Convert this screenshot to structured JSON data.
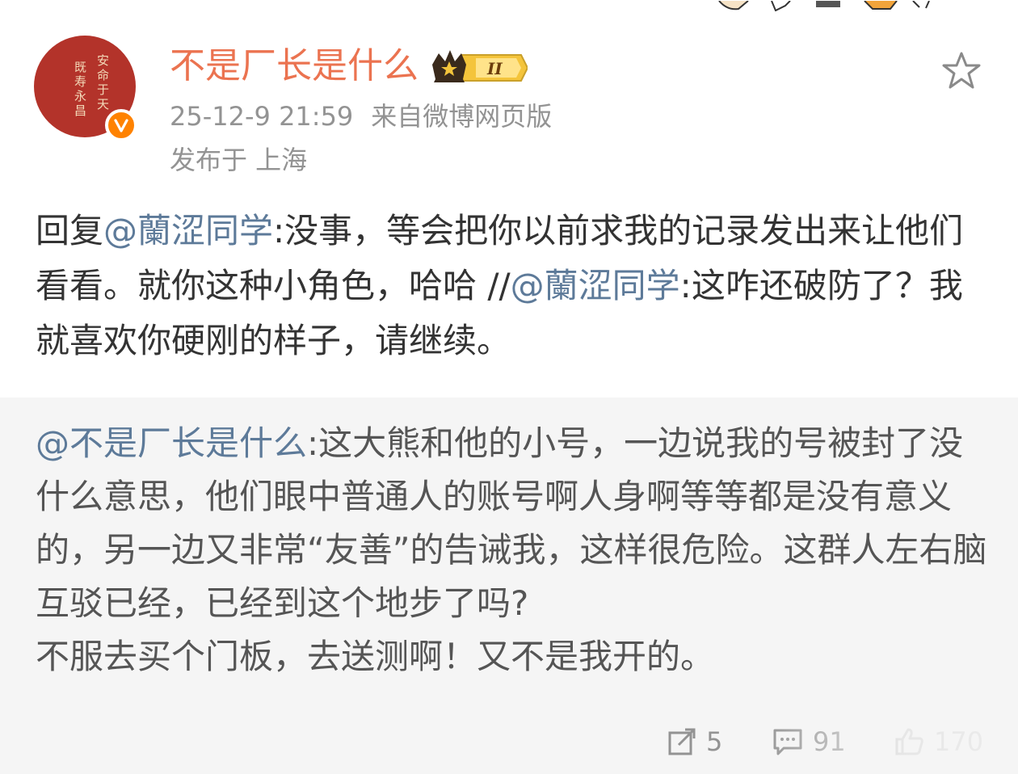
{
  "author": {
    "name": "不是厂长是什么",
    "avatar_seal_text": "安命于天 既寿永昌",
    "verified_icon": "verified-badge-icon",
    "vip_badge_icon": "crown-level-badge-icon",
    "vip_level": "II"
  },
  "meta": {
    "datetime": "25-12-9 21:59",
    "source": "来自微博网页版",
    "location": "发布于 上海"
  },
  "post": {
    "prefix": "回复",
    "mention1": "@蘭涩同学",
    "text1": ":没事，等会把你以前求我的记录发出来让他们看看。就你这种小角色，哈哈 //",
    "mention2": "@蘭涩同学",
    "text2": ":这咋还破防了？我就喜欢你硬刚的样子，请继续。"
  },
  "retweet": {
    "mention": "@不是厂长是什么",
    "text": ":这大熊和他的小号，一边说我的号被封了没什么意思，他们眼中普通人的账号啊人身啊等等都是没有意义的，另一边又非常“友善”的告诫我，这样很危险。这群人左右脑互驳已经，已经到这个地步了吗?",
    "text2": "不服去买个门板，去送测啊！又不是我开的。"
  },
  "actions": {
    "repost_count": "5",
    "comment_count": "91",
    "like_count": "170"
  },
  "colors": {
    "name": "#eb7350",
    "mention": "#5d7a99",
    "meta": "#939393",
    "retweet_bg": "#f5f5f5",
    "verified": "#ff8200",
    "avatar": "#b3332a"
  }
}
